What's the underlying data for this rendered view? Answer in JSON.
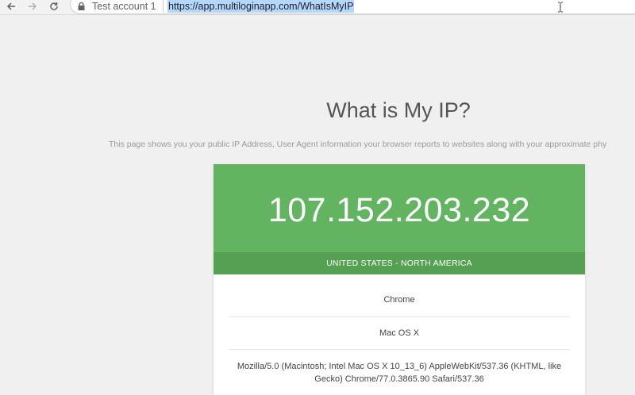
{
  "browser": {
    "account_label": "Test account 1",
    "url": "https://app.multiloginapp.com/WhatIsMyIP",
    "icons": [
      "back-arrow-icon",
      "forward-arrow-icon",
      "reload-icon",
      "lock-icon",
      "text-cursor-icon"
    ]
  },
  "page": {
    "title": "What is My IP?",
    "subtitle": "This page shows you your public IP Address, User Agent information your browser reports to websites along with your approximate phy"
  },
  "ip_card": {
    "ip_address": "107.152.203.232",
    "region": "UNITED STATES - NORTH AMERICA",
    "browser": "Chrome",
    "os": "Mac OS X",
    "user_agent": "Mozilla/5.0 (Macintosh; Intel Mac OS X 10_13_6) AppleWebKit/537.36 (KHTML, like Gecko) Chrome/77.0.3865.90 Safari/537.36",
    "colors": {
      "ip_panel": "#62b460",
      "region_bar": "#55a052"
    }
  }
}
